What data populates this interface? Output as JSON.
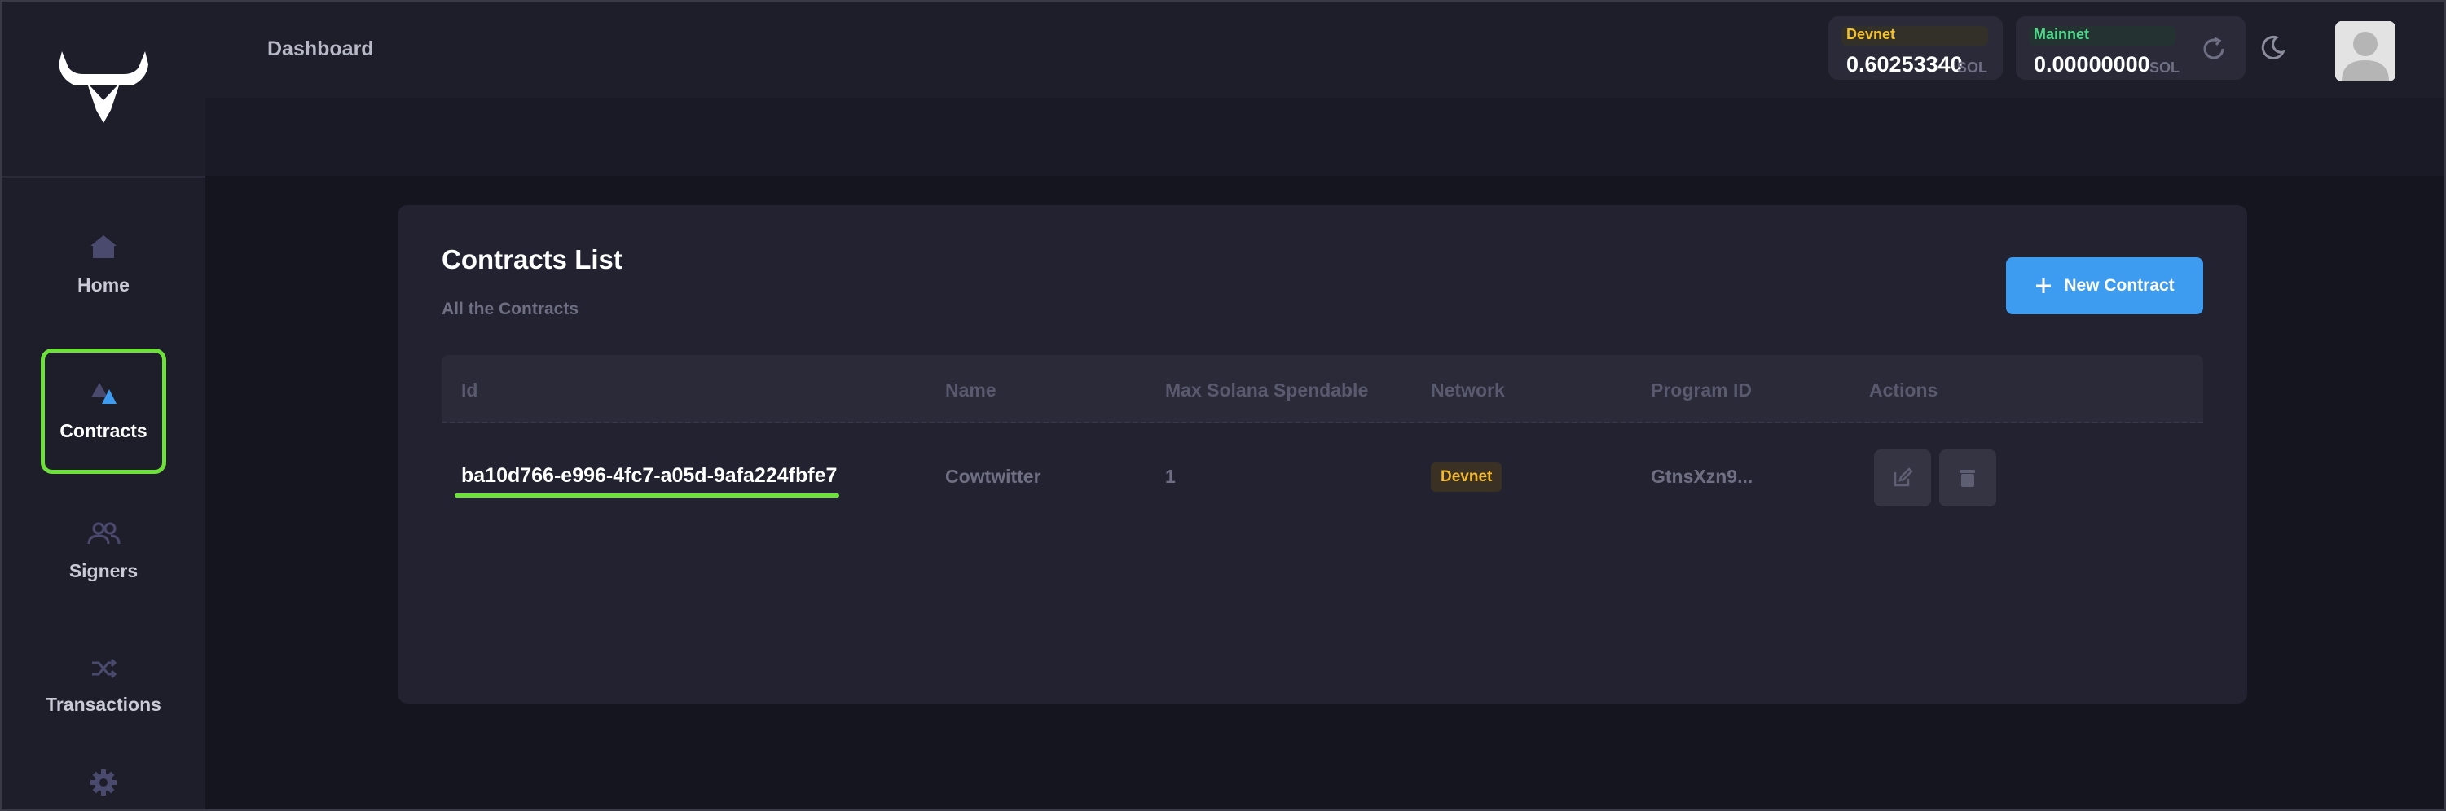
{
  "header": {
    "title": "Dashboard",
    "wallets": [
      {
        "network": "Devnet",
        "amount": "0.60253340",
        "unit": "SOL",
        "color": "#f2c12e"
      },
      {
        "network": "Mainnet",
        "amount": "0.00000000",
        "unit": "SOL",
        "color": "#4fd68a"
      }
    ],
    "icons": {
      "refresh": "refresh-icon",
      "theme": "moon-icon",
      "avatar": "user-avatar"
    }
  },
  "sidebar": {
    "logo": "bull-logo",
    "items": [
      {
        "label": "Home",
        "icon": "home-icon",
        "active": false
      },
      {
        "label": "Contracts",
        "icon": "contracts-icon",
        "active": true
      },
      {
        "label": "Signers",
        "icon": "users-icon",
        "active": false
      },
      {
        "label": "Transactions",
        "icon": "shuffle-icon",
        "active": false
      },
      {
        "label": "",
        "icon": "gear-icon",
        "active": false
      }
    ]
  },
  "main": {
    "title": "Contracts List",
    "subtitle": "All the Contracts",
    "new_button_label": "New Contract",
    "table": {
      "columns": [
        "Id",
        "Name",
        "Max Solana Spendable",
        "Network",
        "Program ID",
        "Actions"
      ],
      "rows": [
        {
          "id": "ba10d766-e996-4fc7-a05d-9afa224fbfe7",
          "name": "Cowtwitter",
          "max_spendable": "1",
          "network": "Devnet",
          "program_id": "GtnsXzn9..."
        }
      ]
    }
  },
  "colors": {
    "accent_blue": "#3d9cf0",
    "highlight_green": "#6ee03c",
    "devnet_yellow": "#f2b92e"
  }
}
